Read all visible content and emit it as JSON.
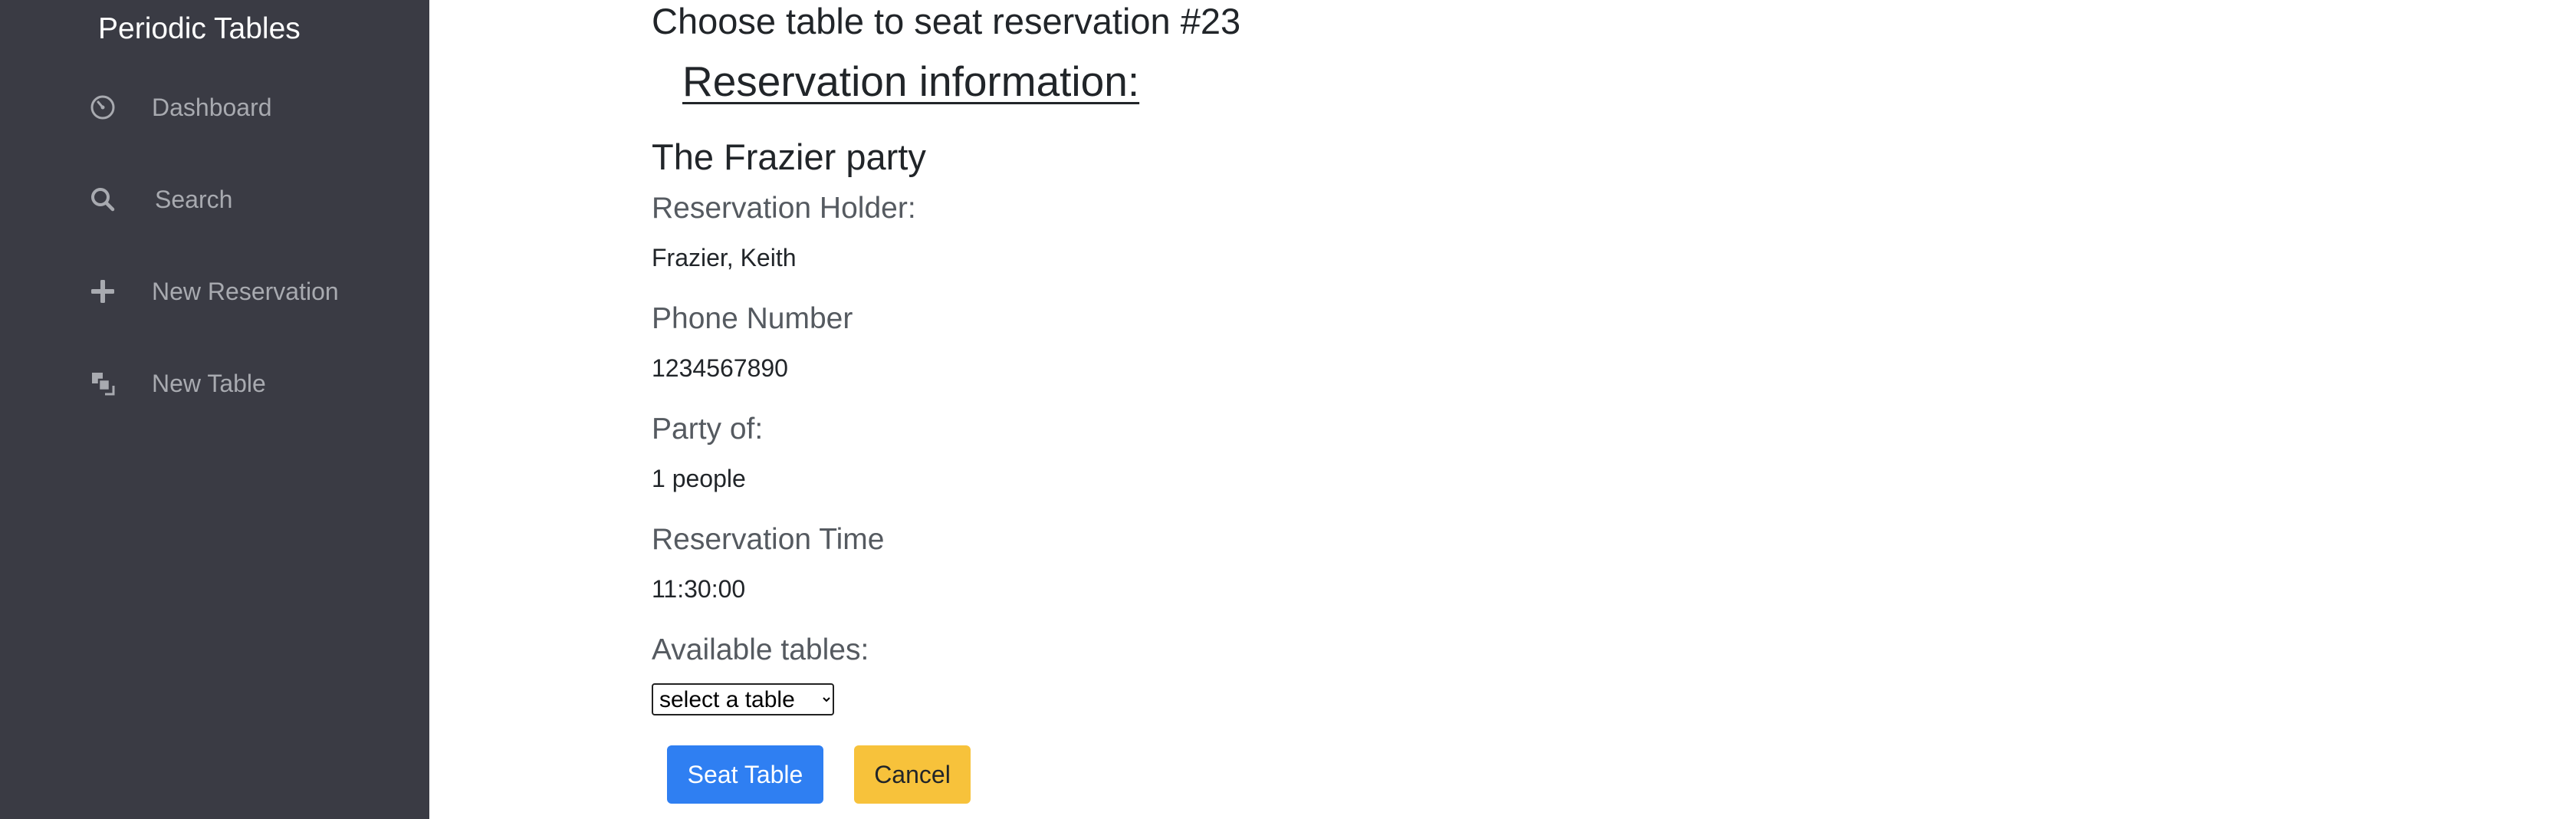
{
  "sidebar": {
    "brand": "Periodic Tables",
    "items": [
      {
        "label": "Dashboard",
        "icon": "dashboard-icon"
      },
      {
        "label": "Search",
        "icon": "search-icon"
      },
      {
        "label": "New Reservation",
        "icon": "plus-icon"
      },
      {
        "label": "New Table",
        "icon": "new-table-icon"
      }
    ]
  },
  "main": {
    "title": "Choose table to seat reservation #23",
    "section_heading": "Reservation information:",
    "party_name": "The Frazier party",
    "fields": [
      {
        "label": "Reservation Holder:",
        "value": "Frazier, Keith"
      },
      {
        "label": "Phone Number",
        "value": "1234567890"
      },
      {
        "label": "Party of:",
        "value": "1 people"
      },
      {
        "label": "Reservation Time",
        "value": "11:30:00"
      }
    ],
    "tables_label": "Available tables:",
    "table_select": {
      "selected": "select a table"
    },
    "buttons": {
      "seat": "Seat Table",
      "cancel": "Cancel"
    }
  },
  "colors": {
    "sidebar_bg": "#3a3b44",
    "primary": "#2f7ff2",
    "warning": "#f7c23b"
  }
}
